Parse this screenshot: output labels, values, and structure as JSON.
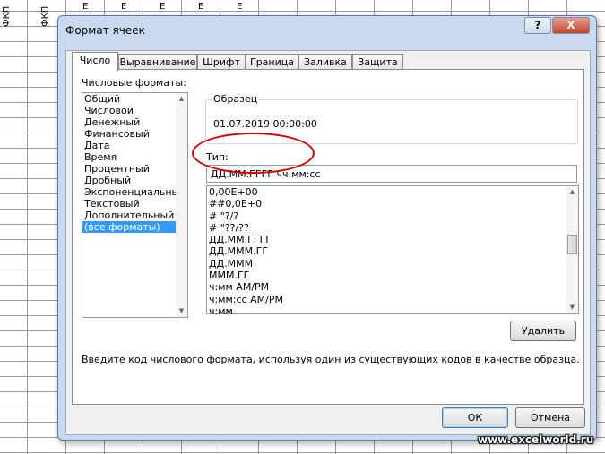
{
  "sheet": {
    "col_headers": [
      "ФКП",
      "ФКП",
      "Е",
      "Е",
      "Е",
      "Е",
      "Е"
    ]
  },
  "dialog": {
    "title": "Формат ячеек",
    "help_label": "?",
    "close_label": "X",
    "tabs": [
      {
        "label": "Число",
        "active": true
      },
      {
        "label": "Выравнивание"
      },
      {
        "label": "Шрифт"
      },
      {
        "label": "Граница"
      },
      {
        "label": "Заливка"
      },
      {
        "label": "Защита"
      }
    ],
    "number_formats_label": "Числовые форматы:",
    "number_formats": [
      "Общий",
      "Числовой",
      "Денежный",
      "Финансовый",
      "Дата",
      "Время",
      "Процентный",
      "Дробный",
      "Экспоненциальный",
      "Текстовый",
      "Дополнительный",
      "(все форматы)"
    ],
    "selected_format": "(все форматы)",
    "sample_label": "Образец",
    "sample_value": "01.07.2019 00:00:00",
    "type_label": "Тип:",
    "type_value": "ДД.ММ.ГГГГ чч:мм:сс",
    "codes": [
      "0,00E+00",
      "##0,0E+0",
      "# \"?/?",
      "# \"??/??",
      "ДД.ММ.ГГГГ",
      "ДД.МММ.ГГ",
      "ДД.МММ",
      "МММ.ГГ",
      "ч:мм AM/PM",
      "ч:мм:сс AM/PM",
      "ч:мм"
    ],
    "delete_label": "Удалить",
    "hint": "Введите код числового формата, используя один из существующих кодов в качестве образца.",
    "ok_label": "ОК",
    "cancel_label": "Отмена"
  },
  "watermark": "www.excelworld.ru",
  "colors": {
    "dialog_frame": "#c9daf0",
    "selection": "#3399ff",
    "annotation": "#d40000"
  }
}
